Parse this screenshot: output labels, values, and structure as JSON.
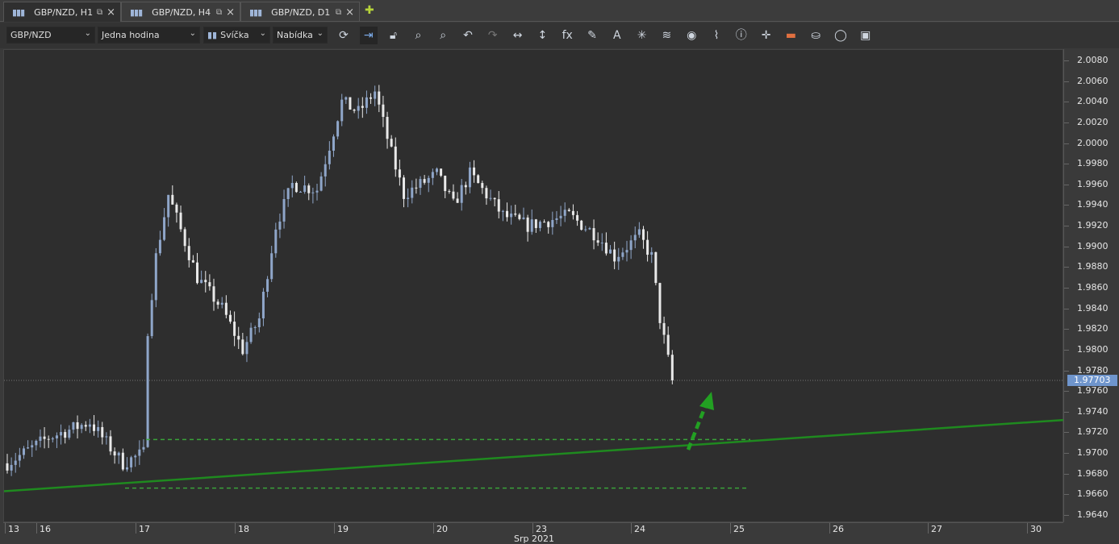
{
  "tabs": [
    {
      "label": "GBP/NZD, H1",
      "active": true
    },
    {
      "label": "GBP/NZD, H4"
    },
    {
      "label": "GBP/NZD, D1"
    }
  ],
  "toolbar": {
    "symbol": "GBP/NZD",
    "timeframe": "Jedna hodina",
    "chart_type": "Svíčka",
    "price_type": "Nabídka",
    "tools": [
      "refresh-icon",
      "auto-scroll-icon",
      "lock-icon",
      "zoom-time-icon",
      "zoom-area-icon",
      "undo-icon",
      "redo-icon",
      "horizontal-resize-icon",
      "vertical-resize-icon",
      "indicators-fx-icon",
      "pencil-draw-icon",
      "text-tool-icon",
      "pattern-tool-icon",
      "layers-icon",
      "visibility-eye-icon",
      "alerts-icon",
      "info-icon",
      "crosshair-icon",
      "color-palette-icon",
      "fill-bucket-icon",
      "template-icon",
      "save-icon"
    ]
  },
  "price_axis": {
    "labels": [
      "2.0080",
      "2.0060",
      "2.0040",
      "2.0020",
      "2.0000",
      "1.9980",
      "1.9960",
      "1.9940",
      "1.9920",
      "1.9900",
      "1.9880",
      "1.9860",
      "1.9840",
      "1.9820",
      "1.9800",
      "1.9780",
      "1.9760",
      "1.9740",
      "1.9720",
      "1.9700",
      "1.9680",
      "1.9660",
      "1.9640"
    ],
    "current": "1.97703",
    "current_value": 1.97703,
    "max": 2.008,
    "min": 1.964
  },
  "time_axis": {
    "days": [
      "13",
      "16",
      "17",
      "18",
      "19",
      "20",
      "23",
      "24",
      "25",
      "26",
      "27",
      "30"
    ],
    "month": "Srp 2021"
  },
  "colors": {
    "bull": "#8fa6c9",
    "bear": "#e9e9e9",
    "trendline": "#1f8a1f",
    "dashed": "#3aa33a",
    "arrow": "#22a022"
  },
  "drawings": {
    "trendline": [
      1.9663,
      1.9732
    ],
    "levels": [
      1.9713,
      1.9666
    ]
  },
  "price_path": [
    [
      0,
      1.969
    ],
    [
      10,
      1.9715
    ],
    [
      20,
      1.973
    ],
    [
      28,
      1.969
    ],
    [
      33,
      1.97
    ],
    [
      34,
      1.982
    ],
    [
      36,
      1.989
    ],
    [
      39,
      1.995
    ],
    [
      46,
      1.987
    ],
    [
      52,
      1.984
    ],
    [
      57,
      1.98
    ],
    [
      61,
      1.983
    ],
    [
      65,
      1.992
    ],
    [
      69,
      1.996
    ],
    [
      75,
      1.9955
    ],
    [
      81,
      2.004
    ],
    [
      85,
      2.003
    ],
    [
      89,
      2.005
    ],
    [
      93,
      1.999
    ],
    [
      96,
      1.995
    ],
    [
      104,
      1.997
    ],
    [
      108,
      1.994
    ],
    [
      112,
      1.997
    ],
    [
      120,
      1.993
    ],
    [
      126,
      1.992
    ],
    [
      136,
      1.993
    ],
    [
      143,
      1.991
    ],
    [
      147,
      1.989
    ],
    [
      153,
      1.991
    ],
    [
      156,
      1.989
    ],
    [
      158,
      1.983
    ],
    [
      160,
      1.979
    ],
    [
      161,
      1.977
    ]
  ]
}
